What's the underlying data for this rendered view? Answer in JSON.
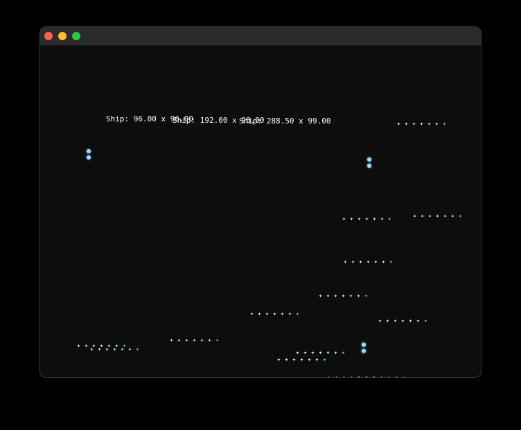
{
  "window": {
    "buttons": [
      {
        "name": "close",
        "color": "#ff5f57"
      },
      {
        "name": "minimize",
        "color": "#febc2e"
      },
      {
        "name": "zoom",
        "color": "#28c840"
      }
    ]
  },
  "colors": {
    "label": "#ffffff",
    "star": "#e9f6ff",
    "star_tail": "#49d1f3",
    "orb": "#9fdcff"
  },
  "scene": {
    "ship_labels": [
      {
        "text": "Ship: 96.00 x 96.00"
      },
      {
        "text": "Ship: 192.00 x 98.00"
      },
      {
        "text": "Ship: 288.50 x 99.00"
      }
    ],
    "star_rows": [
      {
        "count": 7,
        "icon": "sparkle-icon"
      },
      {
        "count": 7,
        "icon": "sparkle-icon"
      },
      {
        "count": 7,
        "icon": "sparkle-icon"
      },
      {
        "count": 7,
        "icon": "sparkle-icon"
      },
      {
        "count": 7,
        "icon": "sparkle-icon"
      },
      {
        "count": 7,
        "icon": "sparkle-icon"
      },
      {
        "count": 7,
        "icon": "sparkle-icon"
      },
      {
        "count": 7,
        "icon": "sparkle-icon"
      },
      {
        "count": 7,
        "icon": "sparkle-icon"
      },
      {
        "count": 7,
        "icon": "sparkle-icon"
      },
      {
        "count": 7,
        "icon": "sparkle-icon"
      },
      {
        "count": 7,
        "icon": "sparkle-icon"
      },
      {
        "count": 7,
        "icon": "sparkle-icon"
      },
      {
        "count": 7,
        "icon": "sparkle-icon"
      }
    ],
    "orb_pairs": [
      {
        "icon": "orb-icon"
      },
      {
        "icon": "orb-icon"
      },
      {
        "icon": "orb-icon"
      }
    ]
  }
}
